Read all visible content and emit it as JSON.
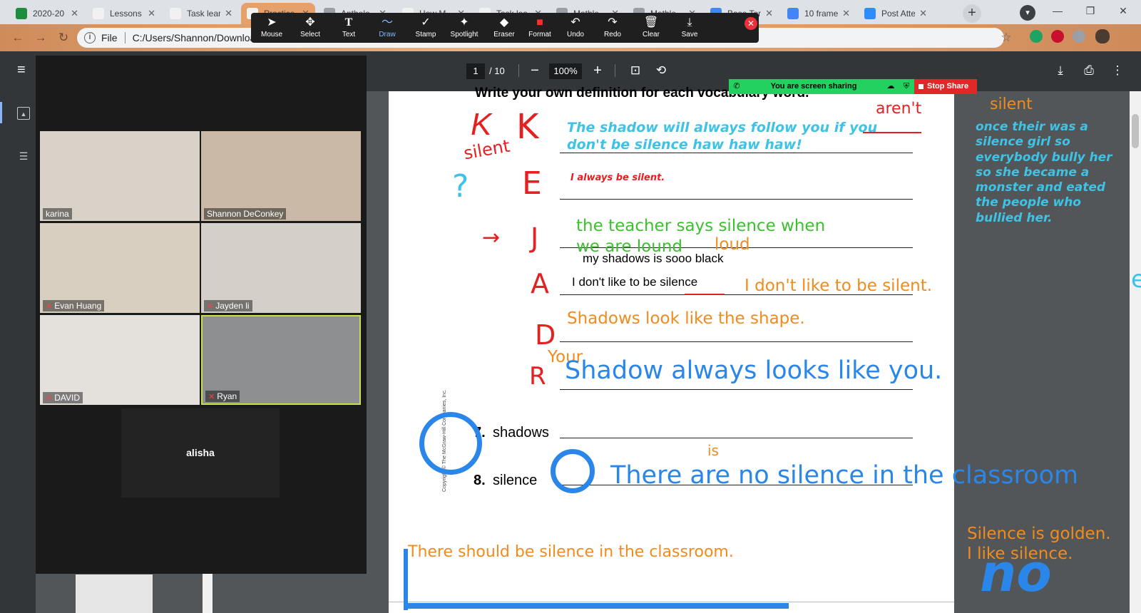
{
  "tabs": [
    {
      "label": "2020-20",
      "fav": "#1e8e3e"
    },
    {
      "label": "Lessons",
      "fav": "#f1f1f1"
    },
    {
      "label": "Task lear",
      "fav": "#f1f1f1"
    },
    {
      "label": "Practice",
      "fav": "#f1f1f1"
    },
    {
      "label": "Antholo",
      "fav": "#9aa0a6"
    },
    {
      "label": "How M",
      "fav": "#f1f1f1"
    },
    {
      "label": "Task lea",
      "fav": "#f1f1f1"
    },
    {
      "label": "Mathle",
      "fav": "#9aa0a6"
    },
    {
      "label": "Mathle",
      "fav": "#9aa0a6"
    },
    {
      "label": "Base Ten",
      "fav": "#4285f4"
    },
    {
      "label": "10 frame",
      "fav": "#4285f4"
    },
    {
      "label": "Post Atte",
      "fav": "#2d8cff"
    }
  ],
  "new_tab": "+",
  "address": {
    "file_label": "File",
    "path": "C:/Users/Shannon/Download"
  },
  "annotation_tools": [
    {
      "label": "Mouse",
      "icon": "mouse-pointer-icon",
      "glyph": "➤"
    },
    {
      "label": "Select",
      "icon": "select-move-icon",
      "glyph": "✥"
    },
    {
      "label": "Text",
      "icon": "text-t-icon",
      "glyph": "T"
    },
    {
      "label": "Draw",
      "icon": "draw-squiggle-icon",
      "glyph": "〜",
      "active": true
    },
    {
      "label": "Stamp",
      "icon": "stamp-check-icon",
      "glyph": "✓"
    },
    {
      "label": "Spotlight",
      "icon": "spotlight-wand-icon",
      "glyph": "✦"
    },
    {
      "label": "Eraser",
      "icon": "eraser-icon",
      "glyph": "◆"
    },
    {
      "label": "Format",
      "icon": "format-color-icon",
      "glyph": "■"
    },
    {
      "label": "Undo",
      "icon": "undo-icon",
      "glyph": "↶"
    },
    {
      "label": "Redo",
      "icon": "redo-icon",
      "glyph": "↷"
    },
    {
      "label": "Clear",
      "icon": "trash-icon",
      "glyph": "🗑"
    },
    {
      "label": "Save",
      "icon": "save-download-icon",
      "glyph": "⤓"
    }
  ],
  "pdf": {
    "page": "1",
    "total": "/ 10",
    "zoom": "100%"
  },
  "share_banner": {
    "text": "You are screen sharing",
    "stop": "Stop Share"
  },
  "participants": [
    {
      "name": "karina",
      "muted": false,
      "bg": "#d9d2c8"
    },
    {
      "name": "Shannon DeConkey",
      "muted": false,
      "bg": "#c9b9a6"
    },
    {
      "name": "Evan Huang",
      "muted": true,
      "bg": "#d8cfc0"
    },
    {
      "name": "Jayden li",
      "muted": true,
      "bg": "#d4cfc9"
    },
    {
      "name": "DAVID",
      "muted": true,
      "bg": "#e4e1dc"
    },
    {
      "name": "Ryan",
      "muted": true,
      "bg": "#8d8f91"
    }
  ],
  "alisha": "alisha",
  "worksheet": {
    "heading": "Write your own definition for each vocabulary word.",
    "item7_num": "7.",
    "item7_word": "shadows",
    "item8_num": "8.",
    "item8_word": "silence",
    "copyright": "Copyright © The McGraw-Hill Companies, Inc.",
    "typed_black_1": "my shadows is sooo black",
    "typed_black_2": "I don't like to be silence"
  },
  "annotations": {
    "k_silent": "silent",
    "k_line": "The shadow will always follow you if you don't be silence haw haw haw!",
    "arent": "aren't",
    "e_line": "I always be silent.",
    "j_line_a": "the teacher says silence when",
    "j_line_b": "we are lound",
    "loud": "loud",
    "a_line": "I don't like to be silent.",
    "d_line": "Shadows look like the shape.",
    "r_your": "Your",
    "r_line": "Shadow always looks like you.",
    "is_fix": "is",
    "silence_line": "There are no silence in the classroom",
    "bottom_line": "There should be silence in the classroom.",
    "right_title": "silent",
    "right_story": "once their was a silence girl so everybody bully her so she became a monster and eated the people who bullied her.",
    "right_golden_1": "Silence is golden.",
    "right_golden_2": "I like silence.",
    "letter_k": "K",
    "letter_e": "E",
    "letter_j": "J",
    "letter_a": "A",
    "letter_d": "D",
    "letter_r": "R",
    "question": "?",
    "arrow": "→",
    "scribble_no": "no",
    "edge_letter": "e"
  },
  "colors": {
    "cyan": "#3ec3e6",
    "orange": "#f08c1e",
    "green": "#3cc030",
    "blue": "#2a86e8",
    "red": "#e52020"
  }
}
